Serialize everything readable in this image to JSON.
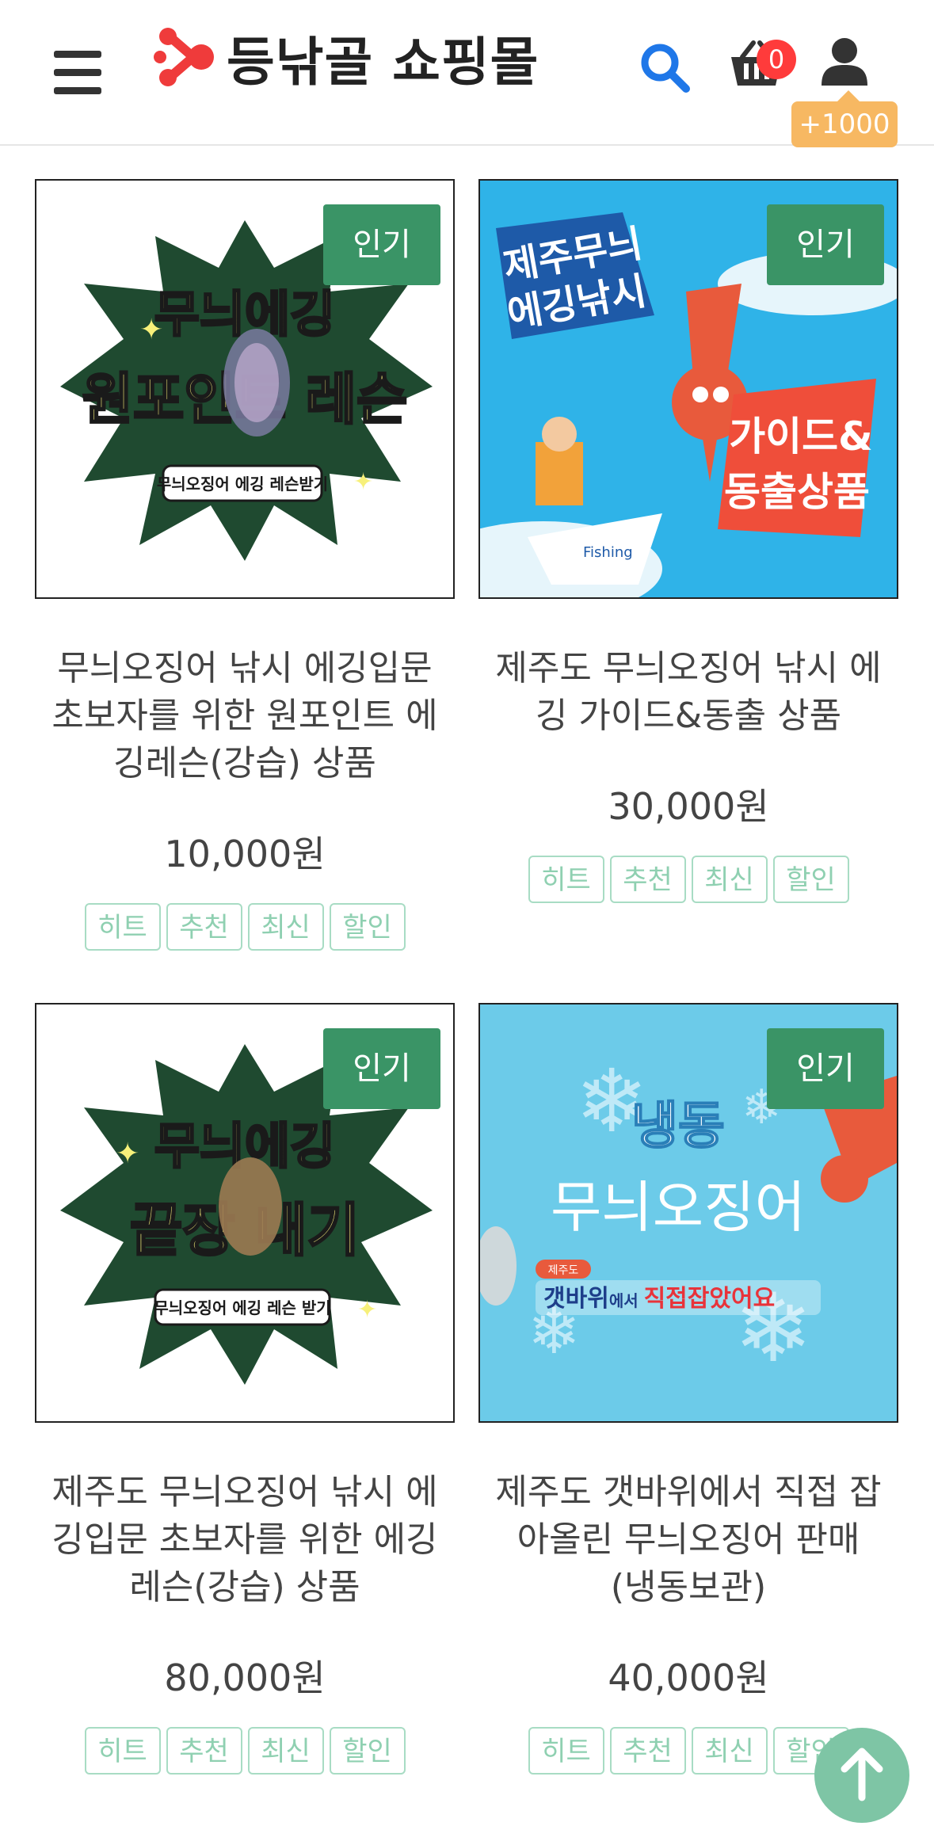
{
  "header": {
    "logo_text": "등낚골 쇼핑몰",
    "cart_count": "0",
    "points": "+1000"
  },
  "colors": {
    "badge_green": "#3a9466",
    "tag_border": "#a8dcc4",
    "cart_badge": "#ff3b3b",
    "points_badge": "#f7b862",
    "search_blue": "#1f77e8"
  },
  "products": [
    {
      "badge": "인기",
      "title": "무늬오징어 낚시 에깅입문 초보자를 위한 원포인트 에깅레슨(강습) 상품",
      "title_lines": [
        "무늬오징어 낚시 에깅입문",
        "초보자를 위한 원포인트 에",
        "깅레슨(강습) 상품"
      ],
      "price": "10,000원",
      "image": {
        "line1": "무늬에깅",
        "line2": "원포인트 레슨",
        "caption": "무늬오징어 에깅 레슨받기"
      },
      "tags": [
        "히트",
        "추천",
        "최신",
        "할인"
      ]
    },
    {
      "badge": "인기",
      "title": "제주도 무늬오징어 낚시 에깅 가이드&동출 상품",
      "title_lines": [
        "제주도 무늬오징어 낚시 에",
        "깅 가이드&동출 상품"
      ],
      "price": "30,000원",
      "image": {
        "line1": "제주무늬",
        "line2": "에깅낚시",
        "line3": "가이드&",
        "line4": "동출상품",
        "boat": "Fishing"
      },
      "tags": [
        "히트",
        "추천",
        "최신",
        "할인"
      ]
    },
    {
      "badge": "인기",
      "title": "제주도 무늬오징어 낚시 에깅입문 초보자를 위한 에깅 레슨(강습) 상품",
      "title_lines": [
        "제주도 무늬오징어 낚시 에",
        "깅입문 초보자를 위한 에깅",
        "레슨(강습) 상품"
      ],
      "price": "80,000원",
      "image": {
        "line1": "무늬에깅",
        "line2": "끝장 내기",
        "caption": "무늬오징어 에깅 레슨 받기"
      },
      "tags": [
        "히트",
        "추천",
        "최신",
        "할인"
      ]
    },
    {
      "badge": "인기",
      "title": "제주도 갯바위에서 직접 잡아올린 무늬오징어 판매(냉동보관)",
      "title_lines": [
        "제주도 갯바위에서 직접 잡",
        "아올린 무늬오징어 판매",
        "(냉동보관)"
      ],
      "price": "40,000원",
      "image": {
        "line1": "냉동",
        "line2": "무늬오징어",
        "small_tag": "제주도",
        "caption_a": "갯바위",
        "caption_b": "에서 ",
        "caption_c": "직접잡았어요"
      },
      "tags": [
        "히트",
        "추천",
        "최신",
        "할인"
      ]
    }
  ]
}
